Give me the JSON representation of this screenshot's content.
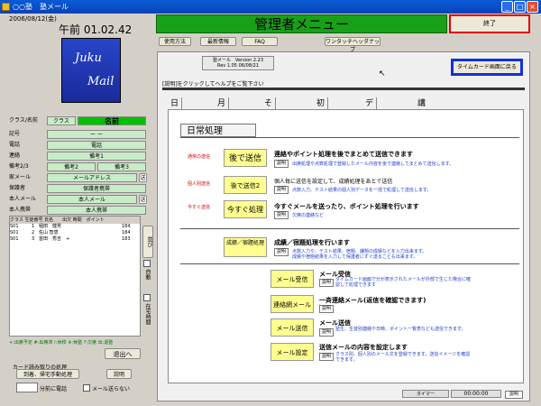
{
  "window": {
    "title": "○○塾　塾メール",
    "minimize": "_",
    "maximize": "□",
    "close": "×"
  },
  "left": {
    "date": "2006/08/12(金)",
    "clock": "午前 01.02.42",
    "logo_line1": "Juku",
    "logo_line2": "Mail",
    "fields": [
      {
        "label": "クラス/名前",
        "value": "クラス",
        "value2": "名前"
      },
      {
        "label": "記号",
        "value": "ー ー"
      },
      {
        "label": "電話",
        "value": "電話"
      },
      {
        "label": "連絡",
        "value": "備考1"
      },
      {
        "label": "備考2/3",
        "value": "備考2",
        "value2": "備考3"
      },
      {
        "label": "家メール",
        "value": "メールアドレス"
      },
      {
        "label": "保護者",
        "value": "保護者携帯"
      },
      {
        "label": "本人メール",
        "value": "本人メール"
      },
      {
        "label": "本人携帯",
        "value": "本人携帯"
      }
    ],
    "list_header": "クラス 生徒番号 氏名　　出欠 時間　ポイント",
    "list_rows": [
      {
        "cls": "S01",
        "no": "1",
        "name": "稲田　健男",
        "val": "184"
      },
      {
        "cls": "S01",
        "no": "2",
        "name": "佐山 智恵",
        "val": "184"
      },
      {
        "cls": "S01",
        "no": "3",
        "name": "首田　秀吉　+",
        "val": "183"
      }
    ],
    "side_tab_1": "並び",
    "auto_label": "自動",
    "stay_label": "在宅時間",
    "legend": "+:出席予定 #:出席済 !:休校 ※:休塾 ?:欠席 出:退塾",
    "exit_btn": "退出へ",
    "card_title": "カード読み取りの処理",
    "card_opt": "到着、帰宅手動処理",
    "card_help": "説明",
    "minutes": "分前に電話",
    "no_mail": "メール送らない"
  },
  "header": {
    "title": "管理者メニュー",
    "exit": "終了"
  },
  "toolbar": {
    "items": [
      "使用方法",
      "最新情報",
      "FAQ",
      "ワンタッチヘッダナップ"
    ]
  },
  "version": {
    "line1": "塾メール　Version 2.23",
    "line2": "Rev 1.05 06/08/21"
  },
  "timecard_btn": "タイムカード画面に戻る",
  "hint": "[説明]をクリックしてヘルプをご覧下さい",
  "tabs": [
    "日常処理",
    "月次処理",
    "その他設定",
    "初期設定",
    "データ処理",
    "講師出勤"
  ],
  "content": {
    "title": "日常処理",
    "rows": [
      {
        "tag": "通常の送信",
        "btn": "後で送信",
        "desc": "連絡やポイント処理を後でまとめて送信できます",
        "help": "説明",
        "sub": "出席処理や点数処理で登録したメール内容を後で連絡してまとめて送信します。"
      },
      {
        "tag": "個人別送信",
        "btn": "後で送信2",
        "desc": "個人毎に送信を設定して、成績処理をあとで送信",
        "help": "説明",
        "sub": "点数入力、テスト結果の個人別データを一括で処理して送信します。"
      },
      {
        "tag": "今すぐ送信",
        "btn": "今すぐ処理",
        "desc": "今すぐメールを送ったり、ポイント処理を行います",
        "help": "説明",
        "sub": "欠席の連絡など"
      }
    ],
    "grade": {
      "btn": "成績／宿題処理",
      "desc": "成績／宿題処理を行います",
      "help": "説明",
      "sub": "点数入力や、テスト結果、宿題、課題の成績などを入力出来ます。成績や宿題結果を入力して保護者にすぐ送ることも出来ます。"
    },
    "mail": [
      {
        "btn": "メール受信",
        "desc": "メール受信",
        "help": "説明",
        "sub": "タイムカード画面で分が表示されたメールが外部で生じた場合に確認して処理できます"
      },
      {
        "btn": "連絡網メール",
        "desc": "一斉連絡メール(返信を確認できます)",
        "help": "説明",
        "sub": ""
      },
      {
        "btn": "メール送信",
        "desc": "メール送信",
        "help": "説明",
        "sub": "塾生、生徒別連絡や日時、ポイント一覧表なども送信できます。"
      },
      {
        "btn": "メール設定",
        "desc": "送信メールの内容を設定します",
        "help": "説明",
        "sub": "クラス別、個人別のメール文を登録できます。送信イメージを確認できます。"
      }
    ]
  },
  "status": {
    "timer_label": "タイマー",
    "timer": "00:00:00",
    "help": "説明"
  }
}
